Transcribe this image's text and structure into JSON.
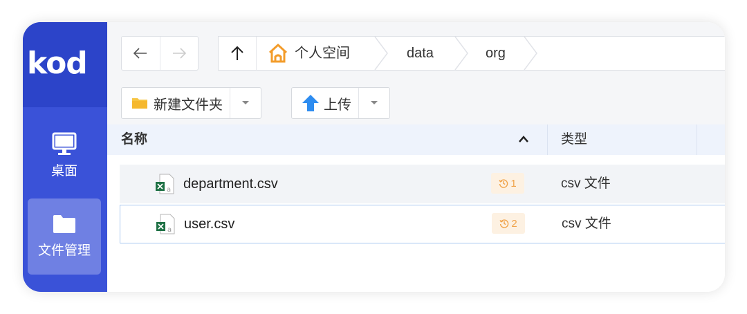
{
  "app": {
    "logo_text": "kod"
  },
  "sidebar": {
    "items": [
      {
        "label": "桌面",
        "icon": "monitor-icon",
        "active": false
      },
      {
        "label": "文件管理",
        "icon": "folder-icon",
        "active": true
      }
    ]
  },
  "nav": {
    "back_icon": "arrow-left-icon",
    "forward_icon": "arrow-right-icon",
    "up_icon": "arrow-up-icon"
  },
  "breadcrumb": [
    {
      "label": "个人空间",
      "icon": "home-icon"
    },
    {
      "label": "data"
    },
    {
      "label": "org"
    }
  ],
  "toolbar": {
    "new_folder_label": "新建文件夹",
    "upload_label": "上传"
  },
  "table": {
    "columns": {
      "name": "名称",
      "type": "类型"
    },
    "sort": "ascending",
    "rows": [
      {
        "name": "department.csv",
        "history_count": "1",
        "type": "csv 文件"
      },
      {
        "name": "user.csv",
        "history_count": "2",
        "type": "csv 文件",
        "selected": true
      }
    ]
  },
  "colors": {
    "sidebar_bg": "#3a52d8",
    "logo_bg": "#2c44c9",
    "active_item_bg": "#6f80e3",
    "header_bg": "#eef3fc",
    "history_badge_text": "#f0a34a",
    "history_badge_bg": "#fdf1e2",
    "selection_border": "#a8c7f0",
    "home_icon": "#f39c2b",
    "upload_icon": "#2d8cf0",
    "folder_icon": "#f7c543",
    "excel_icon": "#1e7145"
  }
}
